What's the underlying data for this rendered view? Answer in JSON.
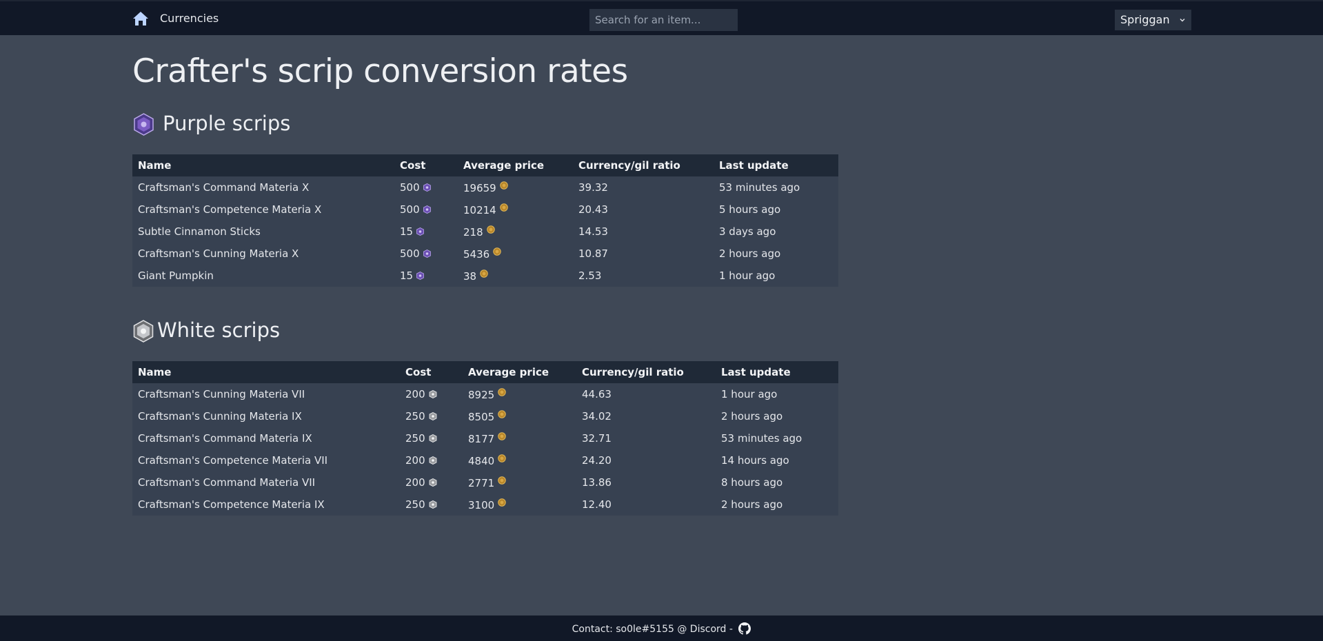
{
  "nav": {
    "home_icon": "home-icon",
    "currencies_link": "Currencies",
    "search_placeholder": "Search for an item...",
    "server": "Spriggan"
  },
  "page_title": "Crafter's scrip conversion rates",
  "purple": {
    "title": "Purple scrips",
    "icon": "purple-scrip-icon",
    "columns": [
      "Name",
      "Cost",
      "Average price",
      "Currency/gil ratio",
      "Last update"
    ],
    "rows": [
      {
        "name": "Craftsman's Command Materia X",
        "cost": "500",
        "price": "19659",
        "ratio": "39.32",
        "updated": "53 minutes ago"
      },
      {
        "name": "Craftsman's Competence Materia X",
        "cost": "500",
        "price": "10214",
        "ratio": "20.43",
        "updated": "5 hours ago"
      },
      {
        "name": "Subtle Cinnamon Sticks",
        "cost": "15",
        "price": "218",
        "ratio": "14.53",
        "updated": "3 days ago"
      },
      {
        "name": "Craftsman's Cunning Materia X",
        "cost": "500",
        "price": "5436",
        "ratio": "10.87",
        "updated": "2 hours ago"
      },
      {
        "name": "Giant Pumpkin",
        "cost": "15",
        "price": "38",
        "ratio": "2.53",
        "updated": "1 hour ago"
      }
    ]
  },
  "white": {
    "title": "White scrips",
    "icon": "white-scrip-icon",
    "columns": [
      "Name",
      "Cost",
      "Average price",
      "Currency/gil ratio",
      "Last update"
    ],
    "rows": [
      {
        "name": "Craftsman's Cunning Materia VII",
        "cost": "200",
        "price": "8925",
        "ratio": "44.63",
        "updated": "1 hour ago"
      },
      {
        "name": "Craftsman's Cunning Materia IX",
        "cost": "250",
        "price": "8505",
        "ratio": "34.02",
        "updated": "2 hours ago"
      },
      {
        "name": "Craftsman's Command Materia IX",
        "cost": "250",
        "price": "8177",
        "ratio": "32.71",
        "updated": "53 minutes ago"
      },
      {
        "name": "Craftsman's Competence Materia VII",
        "cost": "200",
        "price": "4840",
        "ratio": "24.20",
        "updated": "14 hours ago"
      },
      {
        "name": "Craftsman's Command Materia VII",
        "cost": "200",
        "price": "2771",
        "ratio": "13.86",
        "updated": "8 hours ago"
      },
      {
        "name": "Craftsman's Competence Materia IX",
        "cost": "250",
        "price": "3100",
        "ratio": "12.40",
        "updated": "2 hours ago"
      }
    ]
  },
  "footer": {
    "text": "Contact: so0le#5155 @ Discord -",
    "icon": "github-icon"
  },
  "colors": {
    "page_bg": "#3f4856",
    "nav_bg": "#111827",
    "table_head": "#1f2937",
    "table_row": "#374151",
    "purple_scrip": "#7c5cc4",
    "gil_coin": "#c99a2e"
  }
}
